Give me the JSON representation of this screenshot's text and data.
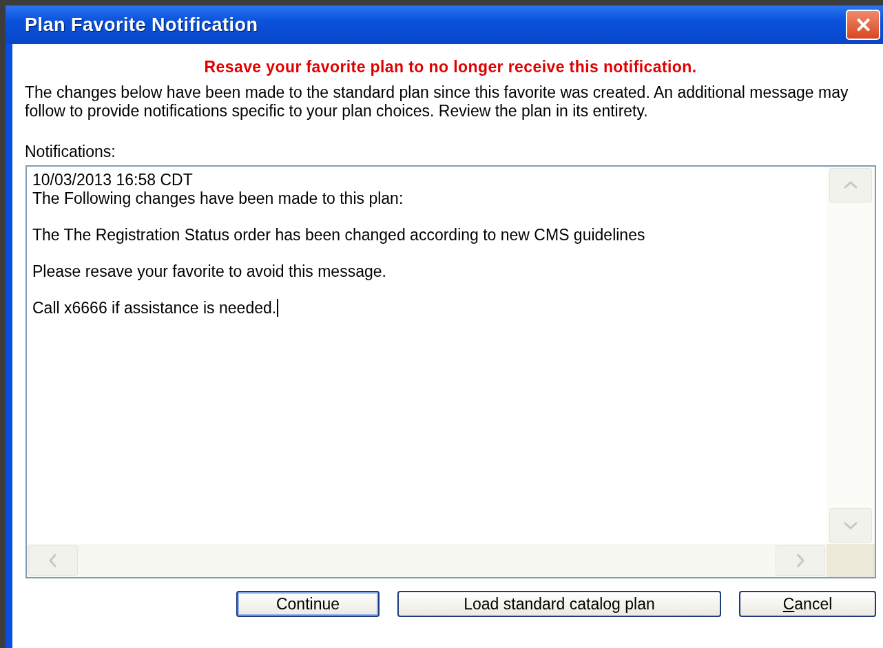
{
  "window": {
    "title": "Plan Favorite Notification",
    "close": "✕"
  },
  "warning": "Resave your favorite plan to no longer receive this notification.",
  "description": "The changes below have been made to the standard plan since this favorite was created. An additional message may follow to provide notifications specific to your plan choices. Review the plan in its entirety.",
  "notifications": {
    "label": "Notifications:",
    "paragraphs": [
      [
        "10/03/2013 16:58 CDT",
        "The Following changes have been made to this plan:"
      ],
      [
        "The The Registration Status order has been changed according to new CMS guidelines"
      ],
      [
        "Please resave your favorite to avoid this message."
      ],
      [
        "Call x6666 if assistance is needed."
      ]
    ],
    "focused": true
  },
  "buttons": [
    {
      "label": "Continue",
      "default": true,
      "access_key": false
    },
    {
      "label": "Load standard catalog plan",
      "default": false,
      "access_key": false
    },
    {
      "label": "Cancel",
      "default": false,
      "access_key": true
    }
  ]
}
